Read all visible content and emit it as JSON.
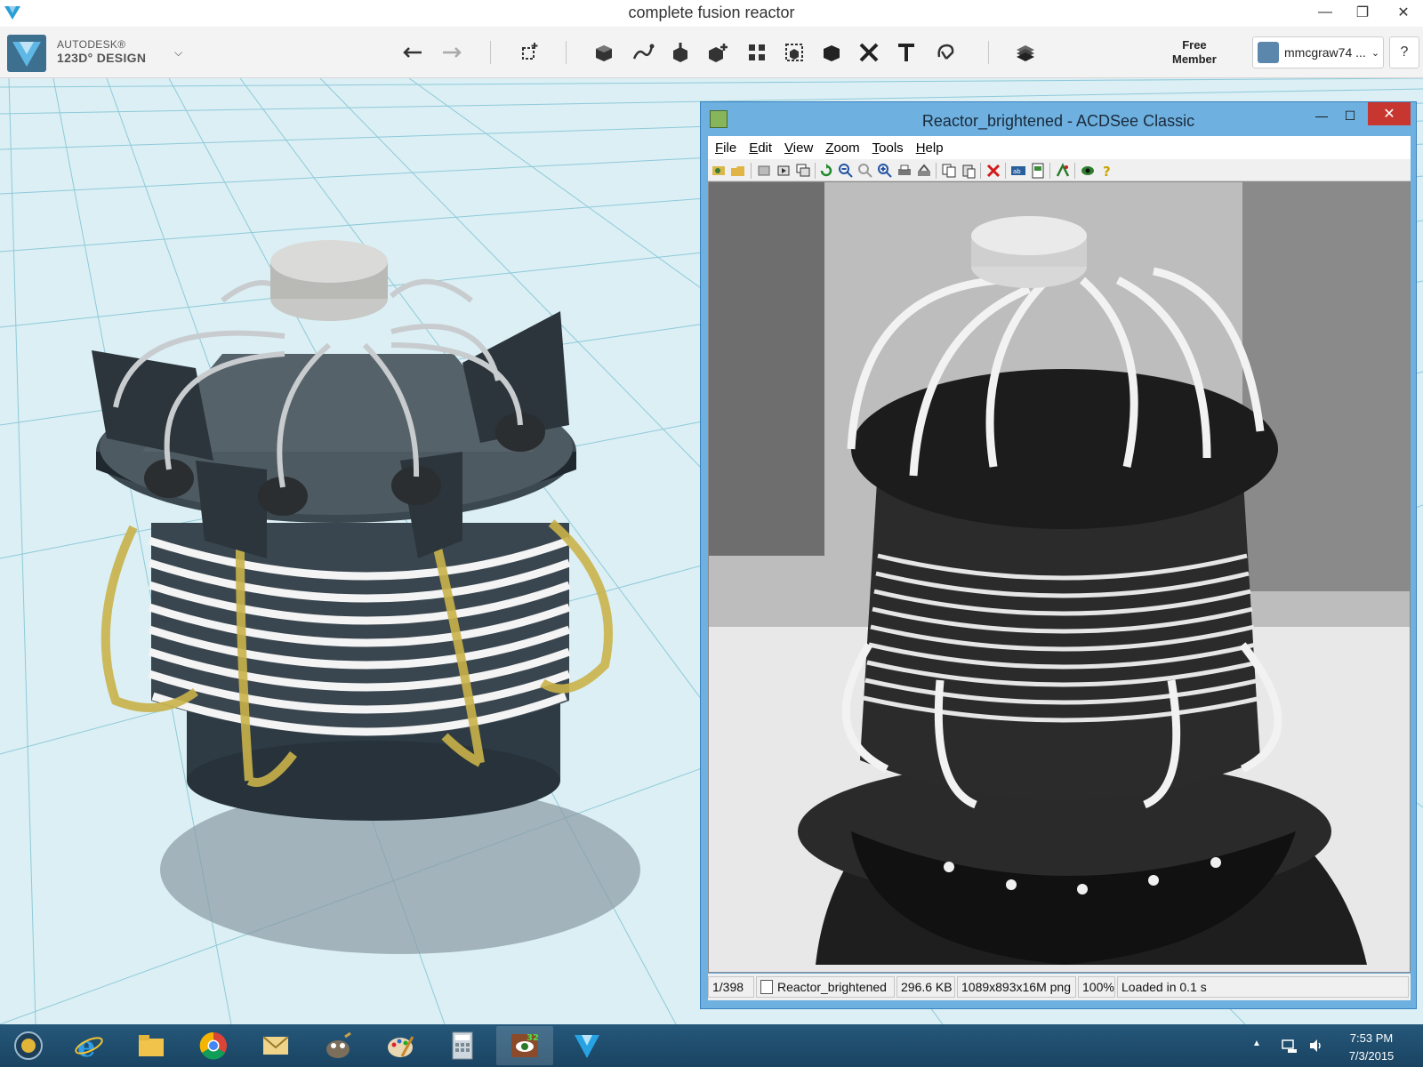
{
  "app": {
    "window_title": "complete fusion reactor",
    "brand_line1": "AUTODESK®",
    "brand_line2": "123D° DESIGN",
    "member_label_line1": "Free",
    "member_label_line2": "Member",
    "username": "mmcgraw74 ...",
    "help": "?",
    "toolbar_icons": [
      "undo-icon",
      "redo-icon",
      "transform-icon",
      "primitives-icon",
      "sketch-icon",
      "construct-icon",
      "modify-icon",
      "pattern-icon",
      "grouping-icon",
      "combine-icon",
      "measure-icon",
      "text-icon",
      "snap-icon",
      "material-icon"
    ]
  },
  "acdsee": {
    "window_title": "Reactor_brightened - ACDSee Classic",
    "menu": [
      "File",
      "Edit",
      "View",
      "Zoom",
      "Tools",
      "Help"
    ],
    "menu_access_keys": [
      "F",
      "E",
      "V",
      "Z",
      "T",
      "H"
    ],
    "status": {
      "index": "1/398",
      "filename": "Reactor_brightened",
      "size": "296.6 KB",
      "dimensions": "1089x893x16M png",
      "zoom": "100%",
      "load_time": "Loaded in 0.1 s"
    }
  },
  "taskbar": {
    "apps": [
      "start-button",
      "internet-explorer-icon",
      "file-explorer-icon",
      "chrome-icon",
      "mail-icon",
      "gimp-icon",
      "paint-icon",
      "calculator-icon",
      "acdsee-icon",
      "123d-design-icon"
    ],
    "active_app": "acdsee-icon",
    "time": "7:53 PM",
    "date": "7/3/2015"
  },
  "colors": {
    "accent": "#3d6f8e",
    "grid_bg": "#dbeff4",
    "acdsee_frame": "#6eb0e0",
    "close_red": "#c7372f",
    "taskbar": "#1f4d6e"
  }
}
